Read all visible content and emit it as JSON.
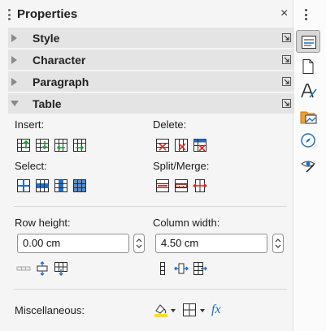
{
  "panel": {
    "title": "Properties",
    "close_glyph": "×",
    "menu_icon": "vertical-dots-icon"
  },
  "sections": [
    {
      "label": "Style",
      "expanded": false
    },
    {
      "label": "Character",
      "expanded": false
    },
    {
      "label": "Paragraph",
      "expanded": false
    },
    {
      "label": "Table",
      "expanded": true
    }
  ],
  "table": {
    "insert_label": "Insert:",
    "delete_label": "Delete:",
    "select_label": "Select:",
    "split_merge_label": "Split/Merge:",
    "row_height_label": "Row height:",
    "row_height_value": "0.00 cm",
    "column_width_label": "Column width:",
    "column_width_value": "4.50 cm",
    "misc_label": "Miscellaneous:",
    "fx_glyph": "fx"
  },
  "icons": {
    "insert": [
      "insert-rows-above-icon",
      "insert-rows-below-icon",
      "insert-columns-before-icon",
      "insert-columns-after-icon"
    ],
    "delete": [
      "delete-rows-icon",
      "delete-columns-icon",
      "delete-table-icon"
    ],
    "select": [
      "select-table-icon",
      "select-row-icon",
      "select-column-icon",
      "select-cell-icon"
    ],
    "split_merge": [
      "split-cells-icon",
      "merge-cells-icon",
      "split-table-icon"
    ],
    "row_tools": [
      "minimal-row-height-icon",
      "optimal-row-height-icon",
      "distribute-rows-icon"
    ],
    "column_tools": [
      "minimal-column-width-icon",
      "optimal-column-width-icon",
      "distribute-columns-icon"
    ],
    "misc": [
      "cell-background-color-icon",
      "borders-icon",
      "sum-icon"
    ]
  },
  "sidebar_tabs": [
    "properties-icon",
    "page-icon",
    "styles-icon",
    "gallery-icon",
    "navigator-icon",
    "style-inspector-icon"
  ],
  "colors": {
    "accent_blue": "#1e6fc4",
    "delete_red": "#d9302b",
    "highlight_yellow": "#ffe100",
    "header_gray": "#e4e4e4"
  }
}
